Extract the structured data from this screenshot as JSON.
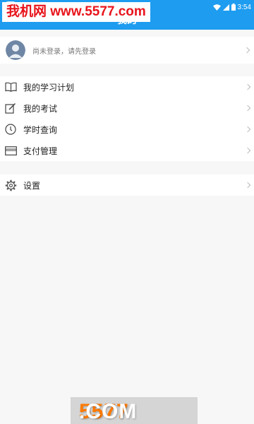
{
  "header": {
    "title": "我的"
  },
  "status_bar": {
    "time": "3:54"
  },
  "watermark": {
    "top_text": "我机网 www.5577.com",
    "bottom_digits": "5577",
    "bottom_suffix": ".COM"
  },
  "profile": {
    "prompt": "尚未登录，请先登录"
  },
  "menu": [
    {
      "label": "我的学习计划",
      "icon": "book-icon"
    },
    {
      "label": "我的考试",
      "icon": "edit-icon"
    },
    {
      "label": "学时查询",
      "icon": "clock-icon"
    },
    {
      "label": "支付管理",
      "icon": "card-icon"
    }
  ],
  "settings": {
    "label": "设置",
    "icon": "gear-icon"
  },
  "colors": {
    "primary": "#1e9cf0",
    "background": "#f7f7f7",
    "watermark_red": "#e8141b",
    "watermark_orange": "#ff7a00"
  }
}
